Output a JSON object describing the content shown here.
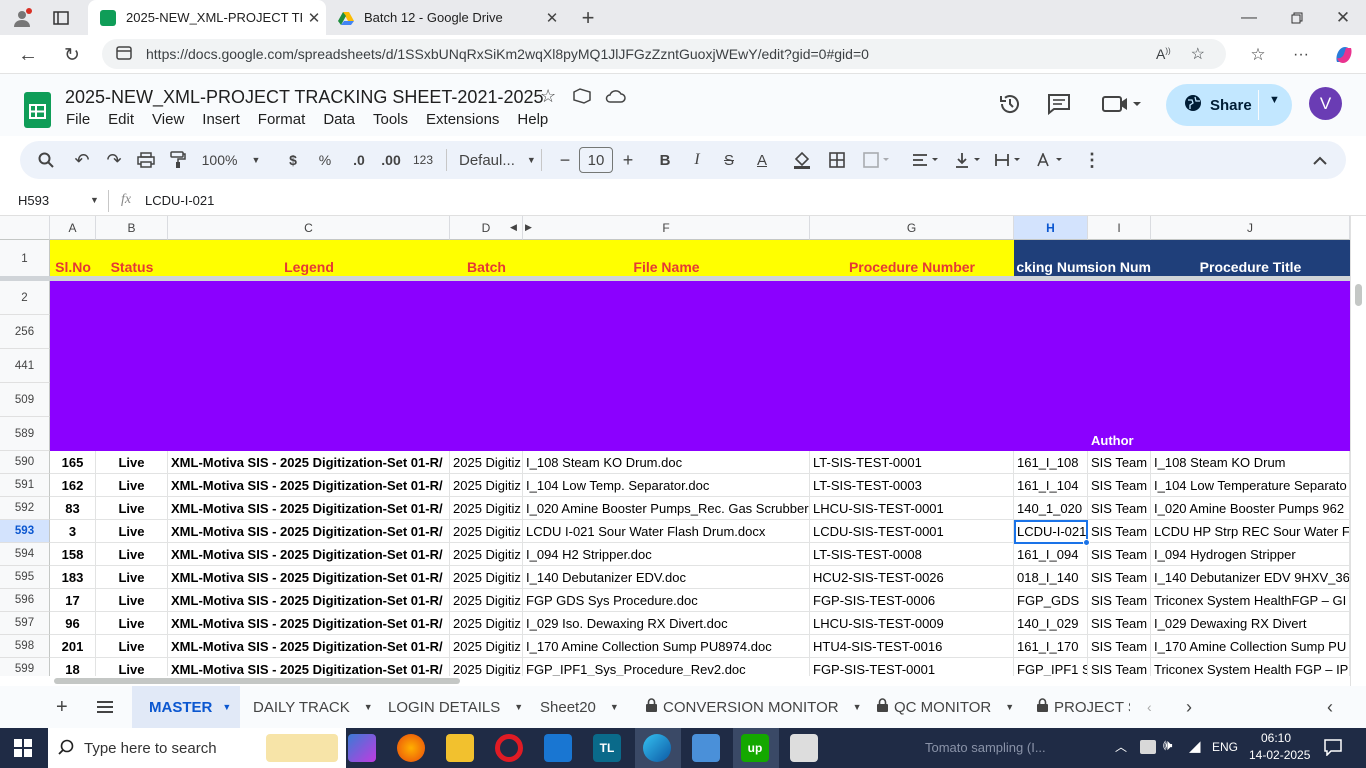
{
  "browser": {
    "tabs": [
      {
        "title": "2025-NEW_XML-PROJECT TRACK",
        "active": true
      },
      {
        "title": "Batch 12 - Google Drive",
        "active": false
      }
    ],
    "url": "https://docs.google.com/spreadsheets/d/1SSxbUNqRxSiKm2wqXl8pyMQ1JlJFGzZzntGuoxjWEwY/edit?gid=0#gid=0"
  },
  "app": {
    "title": "2025-NEW_XML-PROJECT TRACKING SHEET-2021-2025",
    "menus": [
      "File",
      "Edit",
      "View",
      "Insert",
      "Format",
      "Data",
      "Tools",
      "Extensions",
      "Help"
    ],
    "share_label": "Share",
    "avatar_letter": "V"
  },
  "toolbar": {
    "zoom": "100%",
    "currency": "$",
    "percent": "%",
    "dec_less": ".0",
    "dec_more": ".00",
    "number_format": "123",
    "font": "Defaul...",
    "font_size": "10"
  },
  "formula": {
    "cell_ref": "H593",
    "fx": "fx",
    "value": "LCDU-I-021"
  },
  "columns": [
    "A",
    "B",
    "C",
    "D",
    "F",
    "G",
    "H",
    "I",
    "J"
  ],
  "header_row": {
    "num": "1",
    "A": "Sl.No",
    "B": "Status",
    "C": "Legend",
    "D": "Batch",
    "F": "File Name",
    "G": "Procedure Number",
    "H": "cking Num",
    "I": "ision Num",
    "J": "Procedure Title"
  },
  "hidden_rows": [
    "2",
    "256",
    "441",
    "509",
    "589"
  ],
  "author_label": "Author",
  "rows": [
    {
      "n": "590",
      "a": "165",
      "b": "Live",
      "c": "XML-Motiva SIS - 2025 Digitization-Set 01-R/",
      "d": "2025 Digitiz",
      "f": "I_108 Steam KO Drum.doc",
      "g": "LT-SIS-TEST-0001",
      "h": "161_I_108",
      "i": "SIS Team",
      "j": "I_108 Steam KO Drum"
    },
    {
      "n": "591",
      "a": "162",
      "b": "Live",
      "c": "XML-Motiva SIS - 2025 Digitization-Set 01-R/",
      "d": "2025 Digitiz",
      "f": "I_104 Low Temp. Separator.doc",
      "g": "LT-SIS-TEST-0003",
      "h": "161_I_104",
      "i": "SIS Team",
      "j": "I_104 Low Temperature Separato"
    },
    {
      "n": "592",
      "a": "83",
      "b": "Live",
      "c": "XML-Motiva SIS - 2025 Digitization-Set 01-R/",
      "d": "2025 Digitiz",
      "f": "I_020 Amine Booster Pumps_Rec. Gas Scrubber.",
      "g": "LHCU-SIS-TEST-0001",
      "h": "140_1_020",
      "i": "SIS Team",
      "j": "I_020 Amine Booster Pumps 962"
    },
    {
      "n": "593",
      "a": "3",
      "b": "Live",
      "c": "XML-Motiva SIS - 2025 Digitization-Set 01-R/",
      "d": "2025 Digitiz",
      "f": "LCDU I-021 Sour Water Flash Drum.docx",
      "g": "LCDU-SIS-TEST-0001",
      "h": "LCDU-I-021",
      "i": "SIS Team",
      "j": "LCDU HP Strp REC Sour Water F"
    },
    {
      "n": "594",
      "a": "158",
      "b": "Live",
      "c": "XML-Motiva SIS - 2025 Digitization-Set 01-R/",
      "d": "2025 Digitiz",
      "f": "I_094 H2 Stripper.doc",
      "g": "LT-SIS-TEST-0008",
      "h": "161_I_094",
      "i": "SIS Team",
      "j": "I_094 Hydrogen Stripper"
    },
    {
      "n": "595",
      "a": "183",
      "b": "Live",
      "c": "XML-Motiva SIS - 2025 Digitization-Set 01-R/",
      "d": "2025 Digitiz",
      "f": "I_140 Debutanizer EDV.doc",
      "g": "HCU2-SIS-TEST-0026",
      "h": "018_I_140",
      "i": "SIS Team",
      "j": "I_140 Debutanizer EDV 9HXV_36"
    },
    {
      "n": "596",
      "a": "17",
      "b": "Live",
      "c": "XML-Motiva SIS - 2025 Digitization-Set 01-R/",
      "d": "2025 Digitiz",
      "f": "FGP GDS Sys Procedure.doc",
      "g": "FGP-SIS-TEST-0006",
      "h": "FGP_GDS",
      "i": "SIS Team",
      "j": "Triconex System HealthFGP – GI"
    },
    {
      "n": "597",
      "a": "96",
      "b": "Live",
      "c": "XML-Motiva SIS - 2025 Digitization-Set 01-R/",
      "d": "2025 Digitiz",
      "f": "I_029 Iso. Dewaxing RX Divert.doc",
      "g": "LHCU-SIS-TEST-0009",
      "h": "140_I_029",
      "i": "SIS Team",
      "j": "I_029 Dewaxing RX Divert"
    },
    {
      "n": "598",
      "a": "201",
      "b": "Live",
      "c": "XML-Motiva SIS - 2025 Digitization-Set 01-R/",
      "d": "2025 Digitiz",
      "f": "I_170 Amine Collection Sump PU8974.doc",
      "g": "HTU4-SIS-TEST-0016",
      "h": "161_I_170",
      "i": "SIS Team",
      "j": "I_170 Amine Collection Sump PU"
    },
    {
      "n": "599",
      "a": "18",
      "b": "Live",
      "c": "XML-Motiva SIS - 2025 Digitization-Set 01-R/",
      "d": "2025 Digitiz",
      "f": "FGP_IPF1_Sys_Procedure_Rev2.doc",
      "g": "FGP-SIS-TEST-0001",
      "h": "FGP_IPF1 S",
      "i": "SIS Team",
      "j": "Triconex System Health FGP – IP"
    }
  ],
  "sheet_tabs": [
    "MASTER",
    "DAILY TRACK",
    "LOGIN DETAILS",
    "Sheet20",
    "CONVERSION MONITOR",
    "QC MONITOR",
    "PROJECT S"
  ],
  "taskbar": {
    "search_placeholder": "Type here to search",
    "notification": "Tomato sampling (I...",
    "lang": "ENG",
    "time": "06:10",
    "date": "14-02-2025"
  },
  "colors": {
    "header_yellow": "#ffff00",
    "header_red": "#e53935",
    "header_navy": "#1f3f7a",
    "purple_band": "#8b00ff",
    "accent": "#0b57d0"
  }
}
